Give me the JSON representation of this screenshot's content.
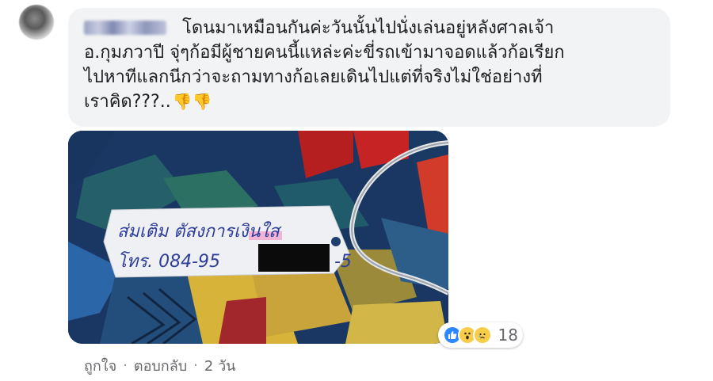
{
  "comment": {
    "author_name": "",
    "lines": [
      "โดนมาเหมือนกันค่ะวันนั้นไปนั่งเล่นอยู่หลังศาลเจ้า",
      "อ.กุมภวาปี จุ่ๆก้อมีผู้ชายคนนี้แหล่ะค่ะขี่รถเข้ามาจอดแล้วก้อเรียก",
      "ไปหาทีแลกนีกว่าจะถามทางก้อเลยเดินไปแต่ที่จริงไม่ใช่อย่างที่",
      "เราคิด???.."
    ],
    "emoji": "👎👎",
    "photo_note": {
      "line1": "ส่มเติม ตัสงการเงินใส",
      "line2": "โทร. 084-95",
      "line2_end": "-5"
    }
  },
  "reactions": {
    "icons": [
      "like-icon",
      "wow-icon",
      "sad-icon"
    ],
    "count": "18"
  },
  "actions": {
    "like": "ถูกใจ",
    "reply": "ตอบกลับ",
    "time": "2 วัน",
    "separator": "·"
  },
  "colors": {
    "bubble": "#f2f3f5",
    "text": "#1c1e21",
    "meta": "#65676b",
    "like_blue": "#2d88ff"
  }
}
